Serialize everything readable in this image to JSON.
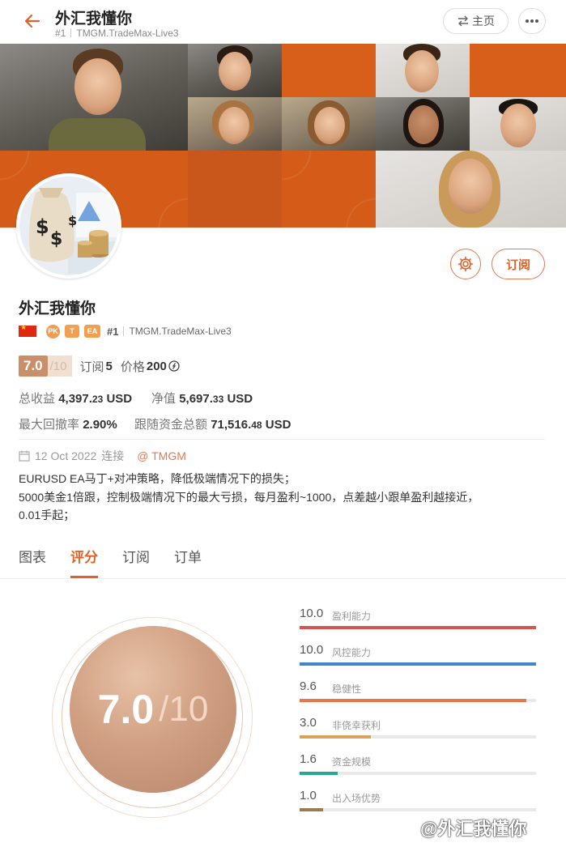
{
  "header": {
    "title": "外汇我懂你",
    "rank": "#1",
    "account": "TMGM.TradeMax-Live3",
    "home_label": "主页"
  },
  "profile": {
    "name": "外汇我懂你",
    "badges": [
      "PK",
      "T",
      "EA"
    ],
    "rank": "#1",
    "account": "TMGM.TradeMax-Live3",
    "subscribe_label": "订阅"
  },
  "score": {
    "value": "7.0",
    "max": "/10",
    "subscriptions_label": "订阅",
    "subscriptions": "5",
    "price_label": "价格",
    "price": "200"
  },
  "stats": {
    "total_profit_label": "总收益",
    "total_profit_main": "4,397.",
    "total_profit_dec": "23",
    "total_profit_unit": "USD",
    "net_label": "净值",
    "net_main": "5,697.",
    "net_dec": "33",
    "net_unit": "USD",
    "drawdown_label": "最大回撤率",
    "drawdown": "2.90%",
    "follow_label": "跟随资金总额",
    "follow_main": "71,516.",
    "follow_dec": "48",
    "follow_unit": "USD"
  },
  "connection": {
    "date": "12 Oct 2022",
    "label": "连接",
    "broker": "@ TMGM"
  },
  "description": [
    "EURUSD EA马丁+对冲策略，降低极端情况下的损失；",
    "5000美金1倍跟，控制极端情况下的最大亏损，每月盈利~1000，点差越小跟单盈利越接近，",
    "0.01手起；"
  ],
  "tabs": [
    "图表",
    "评分",
    "订阅",
    "订单"
  ],
  "active_tab": "评分",
  "rating": {
    "value": "7.0",
    "max": "/10",
    "metrics": [
      {
        "value": "10.0",
        "label": "盈利能力",
        "fraction": 1.0,
        "color": "#d9534f"
      },
      {
        "value": "10.0",
        "label": "风控能力",
        "fraction": 1.0,
        "color": "#3f87c9"
      },
      {
        "value": "9.6",
        "label": "稳健性",
        "fraction": 0.96,
        "color": "#e8764a"
      },
      {
        "value": "3.0",
        "label": "非侥幸获利",
        "fraction": 0.3,
        "color": "#d9a25a"
      },
      {
        "value": "1.6",
        "label": "资金规模",
        "fraction": 0.16,
        "color": "#27a88f"
      },
      {
        "value": "1.0",
        "label": "出入场优势",
        "fraction": 0.1,
        "color": "#9c7a4e"
      }
    ]
  },
  "watermark": "@外汇我懂你"
}
